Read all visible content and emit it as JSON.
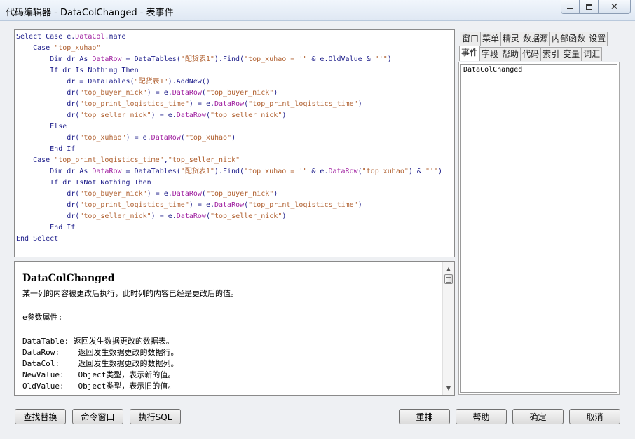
{
  "window": {
    "title": "代码编辑器 - DataColChanged - 表事件",
    "minimize": "",
    "maximize": "",
    "close": "✕"
  },
  "code": {
    "lines": [
      [
        {
          "t": "Select Case ",
          "c": "kw"
        },
        {
          "t": "e.",
          "c": "kw"
        },
        {
          "t": "DataCol",
          "c": "prop"
        },
        {
          "t": ".name",
          "c": "kw"
        }
      ],
      [
        {
          "t": "    Case ",
          "c": "kw"
        },
        {
          "t": "\"top_xuhao\"",
          "c": "str"
        }
      ],
      [
        {
          "t": "        Dim dr As ",
          "c": "kw"
        },
        {
          "t": "DataRow",
          "c": "prop"
        },
        {
          "t": " = DataTables(",
          "c": "kw"
        },
        {
          "t": "\"配货表1\"",
          "c": "str"
        },
        {
          "t": ").Find(",
          "c": "kw"
        },
        {
          "t": "\"top_xuhao = '\"",
          "c": "str"
        },
        {
          "t": " & e.OldValue & ",
          "c": "kw"
        },
        {
          "t": "\"'\"",
          "c": "str"
        },
        {
          "t": ")",
          "c": "kw"
        }
      ],
      [
        {
          "t": "        If dr Is Nothing Then",
          "c": "kw"
        }
      ],
      [
        {
          "t": "            dr = DataTables(",
          "c": "kw"
        },
        {
          "t": "\"配货表1\"",
          "c": "str"
        },
        {
          "t": ").AddNew()",
          "c": "kw"
        }
      ],
      [
        {
          "t": "            dr(",
          "c": "kw"
        },
        {
          "t": "\"top_buyer_nick\"",
          "c": "str"
        },
        {
          "t": ") = e.",
          "c": "kw"
        },
        {
          "t": "DataRow",
          "c": "prop"
        },
        {
          "t": "(",
          "c": "kw"
        },
        {
          "t": "\"top_buyer_nick\"",
          "c": "str"
        },
        {
          "t": ")",
          "c": "kw"
        }
      ],
      [
        {
          "t": "            dr(",
          "c": "kw"
        },
        {
          "t": "\"top_print_logistics_time\"",
          "c": "str"
        },
        {
          "t": ") = e.",
          "c": "kw"
        },
        {
          "t": "DataRow",
          "c": "prop"
        },
        {
          "t": "(",
          "c": "kw"
        },
        {
          "t": "\"top_print_logistics_time\"",
          "c": "str"
        },
        {
          "t": ")",
          "c": "kw"
        }
      ],
      [
        {
          "t": "            dr(",
          "c": "kw"
        },
        {
          "t": "\"top_seller_nick\"",
          "c": "str"
        },
        {
          "t": ") = e.",
          "c": "kw"
        },
        {
          "t": "DataRow",
          "c": "prop"
        },
        {
          "t": "(",
          "c": "kw"
        },
        {
          "t": "\"top_seller_nick\"",
          "c": "str"
        },
        {
          "t": ")",
          "c": "kw"
        }
      ],
      [
        {
          "t": "        Else",
          "c": "kw"
        }
      ],
      [
        {
          "t": "            dr(",
          "c": "kw"
        },
        {
          "t": "\"top_xuhao\"",
          "c": "str"
        },
        {
          "t": ") = e.",
          "c": "kw"
        },
        {
          "t": "DataRow",
          "c": "prop"
        },
        {
          "t": "(",
          "c": "kw"
        },
        {
          "t": "\"top_xuhao\"",
          "c": "str"
        },
        {
          "t": ")",
          "c": "kw"
        }
      ],
      [
        {
          "t": "        End If",
          "c": "kw"
        }
      ],
      [
        {
          "t": "    Case ",
          "c": "kw"
        },
        {
          "t": "\"top_print_logistics_time\"",
          "c": "str"
        },
        {
          "t": ",",
          "c": "kw"
        },
        {
          "t": "\"top_seller_nick\"",
          "c": "str"
        }
      ],
      [
        {
          "t": "        Dim dr As ",
          "c": "kw"
        },
        {
          "t": "DataRow",
          "c": "prop"
        },
        {
          "t": " = DataTables(",
          "c": "kw"
        },
        {
          "t": "\"配货表1\"",
          "c": "str"
        },
        {
          "t": ").Find(",
          "c": "kw"
        },
        {
          "t": "\"top_xuhao = '\"",
          "c": "str"
        },
        {
          "t": " & e.",
          "c": "kw"
        },
        {
          "t": "DataRow",
          "c": "prop"
        },
        {
          "t": "(",
          "c": "kw"
        },
        {
          "t": "\"top_xuhao\"",
          "c": "str"
        },
        {
          "t": ") & ",
          "c": "kw"
        },
        {
          "t": "\"'\"",
          "c": "str"
        },
        {
          "t": ")",
          "c": "kw"
        }
      ],
      [
        {
          "t": "        If dr IsNot Nothing Then",
          "c": "kw"
        }
      ],
      [
        {
          "t": "            dr(",
          "c": "kw"
        },
        {
          "t": "\"top_buyer_nick\"",
          "c": "str"
        },
        {
          "t": ") = e.",
          "c": "kw"
        },
        {
          "t": "DataRow",
          "c": "prop"
        },
        {
          "t": "(",
          "c": "kw"
        },
        {
          "t": "\"top_buyer_nick\"",
          "c": "str"
        },
        {
          "t": ")",
          "c": "kw"
        }
      ],
      [
        {
          "t": "            dr(",
          "c": "kw"
        },
        {
          "t": "\"top_print_logistics_time\"",
          "c": "str"
        },
        {
          "t": ") = e.",
          "c": "kw"
        },
        {
          "t": "DataRow",
          "c": "prop"
        },
        {
          "t": "(",
          "c": "kw"
        },
        {
          "t": "\"top_print_logistics_time\"",
          "c": "str"
        },
        {
          "t": ")",
          "c": "kw"
        }
      ],
      [
        {
          "t": "            dr(",
          "c": "kw"
        },
        {
          "t": "\"top_seller_nick\"",
          "c": "str"
        },
        {
          "t": ") = e.",
          "c": "kw"
        },
        {
          "t": "DataRow",
          "c": "prop"
        },
        {
          "t": "(",
          "c": "kw"
        },
        {
          "t": "\"top_seller_nick\"",
          "c": "str"
        },
        {
          "t": ")",
          "c": "kw"
        }
      ],
      [
        {
          "t": "        End If",
          "c": "kw"
        }
      ],
      [
        {
          "t": "End Select",
          "c": "kw"
        }
      ]
    ]
  },
  "help": {
    "title": "DataColChanged",
    "description": "某一列的内容被更改后执行，此时列的内容已经是更改后的值。",
    "params_heading": "e参数属性:",
    "params": [
      {
        "name": "DataTable:",
        "text": "返回发生数据更改的数据表。"
      },
      {
        "name": "DataRow:  ",
        "text": " 返回发生数据更改的数据行。"
      },
      {
        "name": "DataCol:  ",
        "text": " 返回发生数据更改的数据列。"
      },
      {
        "name": "NewValue: ",
        "text": " Object类型，表示新的值。"
      },
      {
        "name": "OldValue: ",
        "text": " Object类型，表示旧的值。"
      }
    ],
    "scroll_up": "▲",
    "scroll_down": "▼"
  },
  "tabs": {
    "row1": [
      "窗口",
      "菜单",
      "精灵",
      "数据源",
      "内部函数",
      "设置"
    ],
    "row2": [
      "事件",
      "字段",
      "帮助",
      "代码",
      "索引",
      "变量",
      "词汇"
    ],
    "active": "事件",
    "list_items": [
      "DataColChanged"
    ]
  },
  "buttons": {
    "find_replace": "查找替换",
    "command_window": "命令窗口",
    "execute_sql": "执行SQL",
    "rearrange": "重排",
    "help": "帮助",
    "ok": "确定",
    "cancel": "取消"
  },
  "colors": {
    "keyword": "#1d1d8a",
    "string": "#b06030",
    "property": "#a020a0"
  }
}
